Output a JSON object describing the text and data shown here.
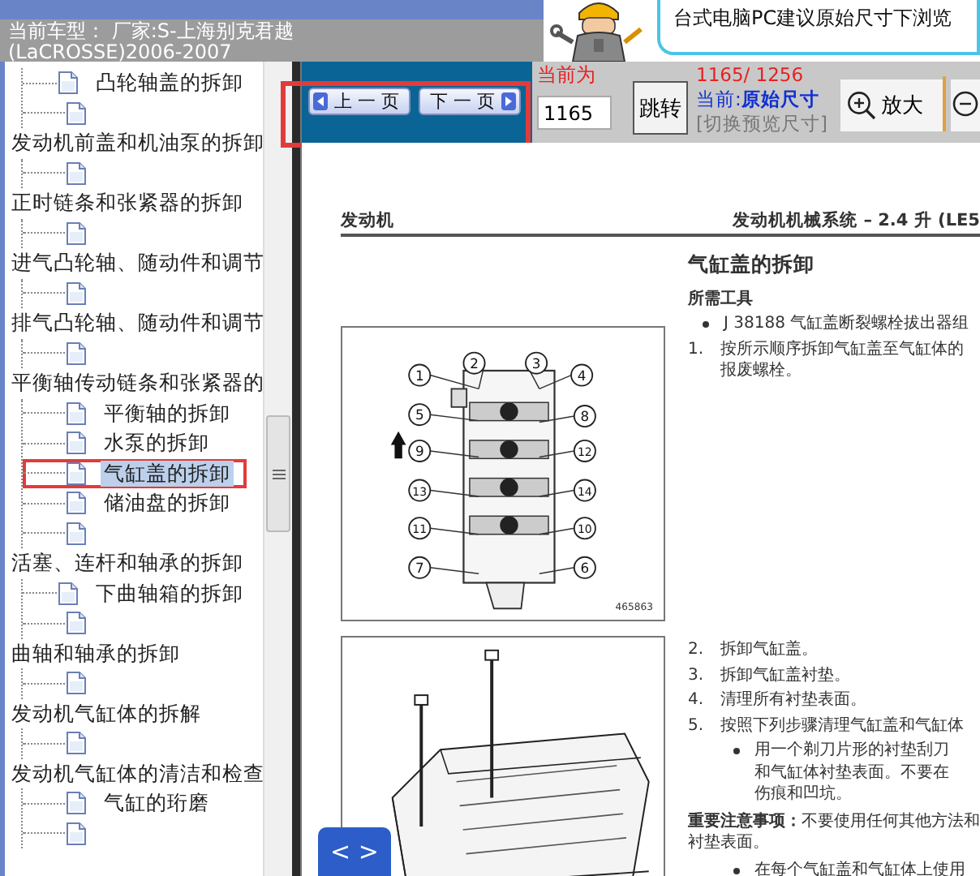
{
  "header": {
    "vehicle": "当前车型： 厂家:S-上海别克君越(LaCROSSE)2006-2007",
    "tip": "台式电脑PC建议原始尺寸下浏览"
  },
  "tree": {
    "items": [
      {
        "children": [
          {
            "label": "凸轮轴盖的拆卸",
            "selected": false
          },
          {
            "selected": false
          }
        ]
      },
      {
        "label": "发动机前盖和机油泵的拆卸",
        "children": [
          {
            "selected": false
          }
        ]
      },
      {
        "label": "正时链条和张紧器的拆卸",
        "children": [
          {
            "selected": false
          }
        ]
      },
      {
        "label": "进气凸轮轴、随动件和调节",
        "children": [
          {
            "selected": false
          }
        ]
      },
      {
        "label": "排气凸轮轴、随动件和调节",
        "children": [
          {
            "selected": false
          }
        ]
      },
      {
        "label": "平衡轴传动链条和张紧器的",
        "children": [
          {
            "label": "平衡轴的拆卸",
            "selected": false
          },
          {
            "label": "水泵的拆卸",
            "selected": false
          },
          {
            "label": "气缸盖的拆卸",
            "selected": true
          },
          {
            "label": "储油盘的拆卸",
            "selected": false
          },
          {
            "selected": false
          }
        ]
      },
      {
        "label": "活塞、连杆和轴承的拆卸",
        "children": [
          {
            "label": "下曲轴箱的拆卸",
            "selected": false
          },
          {
            "selected": false
          }
        ]
      },
      {
        "label": "曲轴和轴承的拆卸",
        "children": [
          {
            "selected": false
          }
        ]
      },
      {
        "label": "发动机气缸体的拆解",
        "children": [
          {
            "selected": false
          }
        ]
      },
      {
        "label": "发动机气缸体的清洁和检查",
        "children": [
          {
            "label": "气缸的珩磨",
            "selected": false
          },
          {
            "selected": false
          }
        ]
      }
    ]
  },
  "toolbar": {
    "prev_button": "上 一 页",
    "next_button": "下 一 页",
    "page_label": "当前为",
    "page_input": "1165",
    "jump_button": "跳转",
    "page_count": "1165/ 1256",
    "size_mode": "当前:**原始尺寸**",
    "size_switch": "[切换预览尺寸]",
    "zoom_in_button": "放大"
  },
  "document": {
    "section": "发动机",
    "chapter": "发动机机械系统 – 2.4 升 (LE5",
    "title": "气缸盖的拆卸",
    "tools_heading": "所需工具",
    "blocks_a": [
      {
        "kind": "bullet",
        "lines": [
          "J 38188 气缸盖断裂螺栓拔出器组"
        ]
      },
      {
        "kind": "step",
        "number": "1.",
        "lines": [
          "按所示顺序拆卸气缸盖至气缸体的",
          "报废螺栓。"
        ]
      }
    ],
    "blocks_b": [
      {
        "kind": "step",
        "number": "2.",
        "lines": [
          "拆卸气缸盖。"
        ]
      },
      {
        "kind": "step",
        "number": "3.",
        "lines": [
          "拆卸气缸盖衬垫。"
        ]
      },
      {
        "kind": "step",
        "number": "4.",
        "lines": [
          "清理所有衬垫表面。"
        ]
      },
      {
        "kind": "step",
        "number": "5.",
        "lines": [
          "按照下列步骤清理气缸盖和气缸体"
        ]
      },
      {
        "kind": "bullet",
        "lines": [
          "用一个剃刀片形的衬垫刮刀",
          "和气缸体衬垫表面。不要在",
          "伤痕和凹坑。"
        ]
      },
      {
        "kind": "note",
        "lines": [
          "**重要注意事项：**不要使用任何其他方法和",
          "衬垫表面。"
        ]
      },
      {
        "kind": "bullet",
        "lines": [
          "在每个气缸盖和气缸体上使用"
        ]
      }
    ],
    "figures": [
      {
        "kind": "bolt-order",
        "callouts": [
          "1",
          "2",
          "3",
          "4",
          "5",
          "8",
          "9",
          "12",
          "13",
          "14",
          "11",
          "10",
          "7",
          "6"
        ],
        "code": "465863"
      },
      {
        "kind": "head-perspective"
      }
    ]
  },
  "nav_button": "< >"
}
